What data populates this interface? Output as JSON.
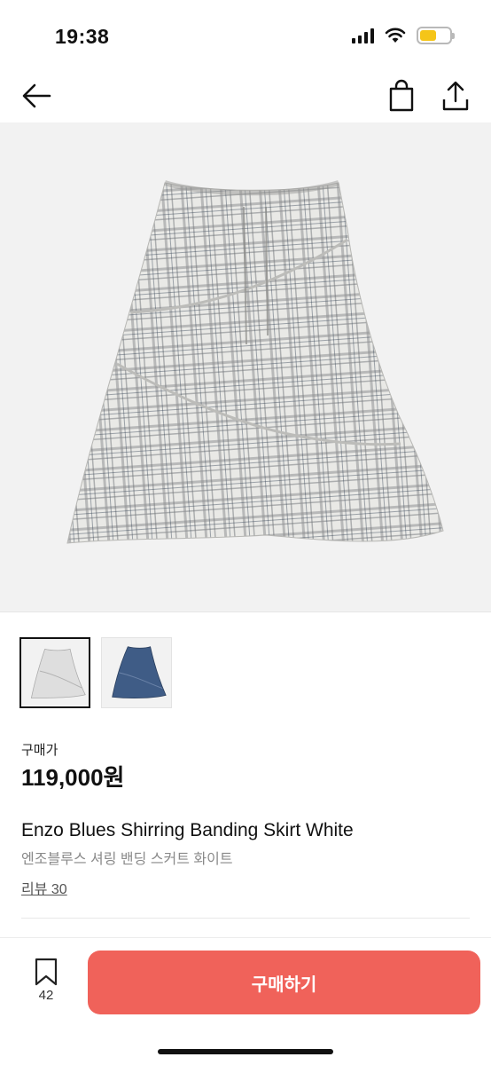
{
  "status_bar": {
    "time": "19:38",
    "icons": [
      "cellular-signal-icon",
      "wifi-icon",
      "battery-icon"
    ],
    "battery_color": "#f5c518"
  },
  "nav": {
    "icons": [
      "back-arrow-icon",
      "shopping-bag-icon",
      "share-icon"
    ]
  },
  "product": {
    "price_label": "구매가",
    "price": "119,000원",
    "name_en": "Enzo Blues Shirring Banding Skirt White",
    "name_ko": "엔조블루스 셔링 밴딩 스커트 화이트",
    "reviews": "리뷰 30",
    "thumbnails": [
      {
        "color": "white",
        "selected": true
      },
      {
        "color": "navy",
        "selected": false
      }
    ]
  },
  "bottom_bar": {
    "bookmark_count": "42",
    "buy_label": "구매하기",
    "accent_color": "#f0625a"
  }
}
